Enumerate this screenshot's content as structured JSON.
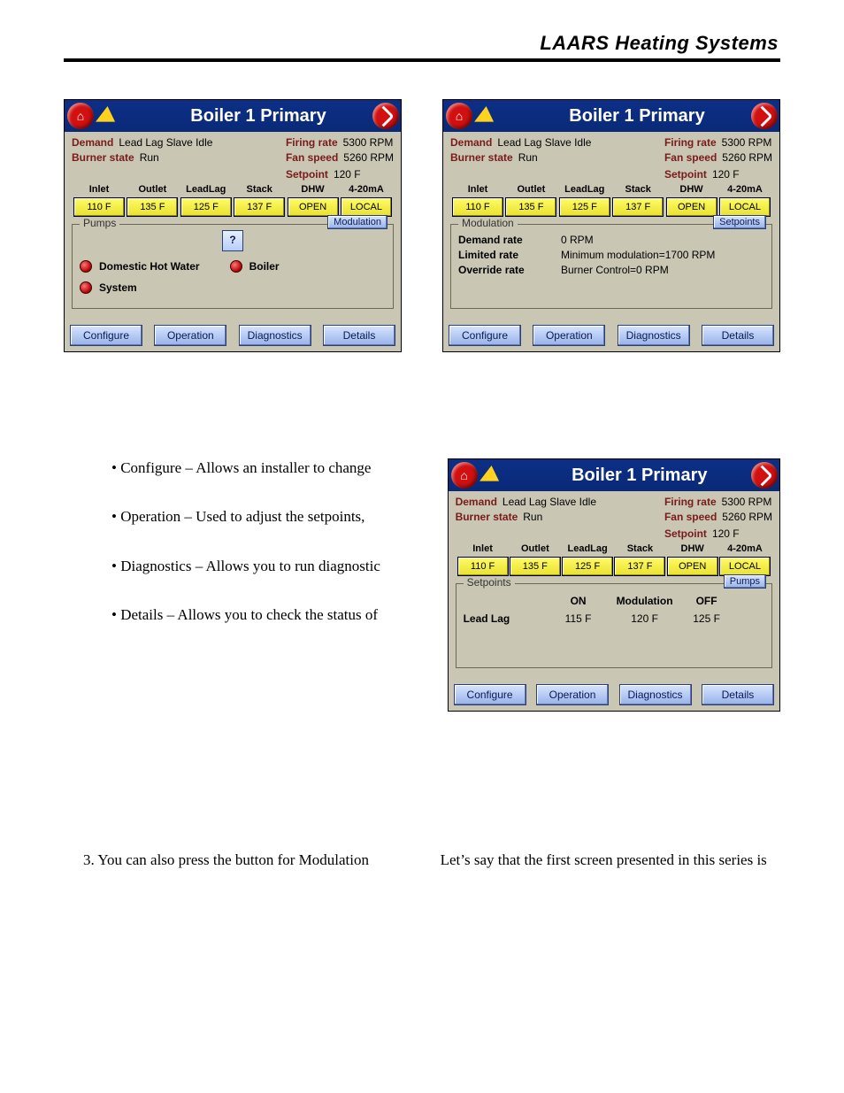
{
  "header": "LAARS Heating Systems",
  "panel_title": "Boiler 1 Primary",
  "status": {
    "demand_k": "Demand",
    "demand_v": "Lead Lag Slave Idle",
    "burner_k": "Burner state",
    "burner_v": "Run",
    "firing_k": "Firing rate",
    "firing_v": "5300 RPM",
    "fan_k": "Fan speed",
    "fan_v": "5260 RPM",
    "setpoint_k": "Setpoint",
    "setpoint_v": "120 F"
  },
  "cols": [
    "Inlet",
    "Outlet",
    "LeadLag",
    "Stack",
    "DHW",
    "4-20mA"
  ],
  "vals": [
    "110 F",
    "135 F",
    "125 F",
    "137 F",
    "OPEN",
    "LOCAL"
  ],
  "panel1": {
    "legend": "Pumps",
    "nav": "Modulation",
    "dhwater": "Domestic Hot Water",
    "boiler": "Boiler",
    "system": "System"
  },
  "panel2": {
    "legend": "Modulation",
    "nav": "Setpoints",
    "rows": [
      {
        "k": "Demand rate",
        "v": "0 RPM"
      },
      {
        "k": "Limited rate",
        "v": "Minimum modulation=1700 RPM"
      },
      {
        "k": "Override rate",
        "v": "Burner Control=0 RPM"
      }
    ]
  },
  "panel3": {
    "legend": "Setpoints",
    "nav": "Pumps",
    "h_on": "ON",
    "h_mod": "Modulation",
    "h_off": "OFF",
    "row_k": "Lead Lag",
    "on": "115 F",
    "mod": "120 F",
    "off": "125 F"
  },
  "footer_btns": [
    "Configure",
    "Operation",
    "Diagnostics",
    "Details"
  ],
  "bullets": [
    "Configure – Allows an installer to change",
    "Operation – Used to adjust the setpoints,",
    "Diagnostics – Allows you to run diagnostic",
    "Details – Allows you to check the status of"
  ],
  "num3": "3.    You can also press the button for Modulation",
  "rtext": "Let’s say that the first screen presented in this series is"
}
